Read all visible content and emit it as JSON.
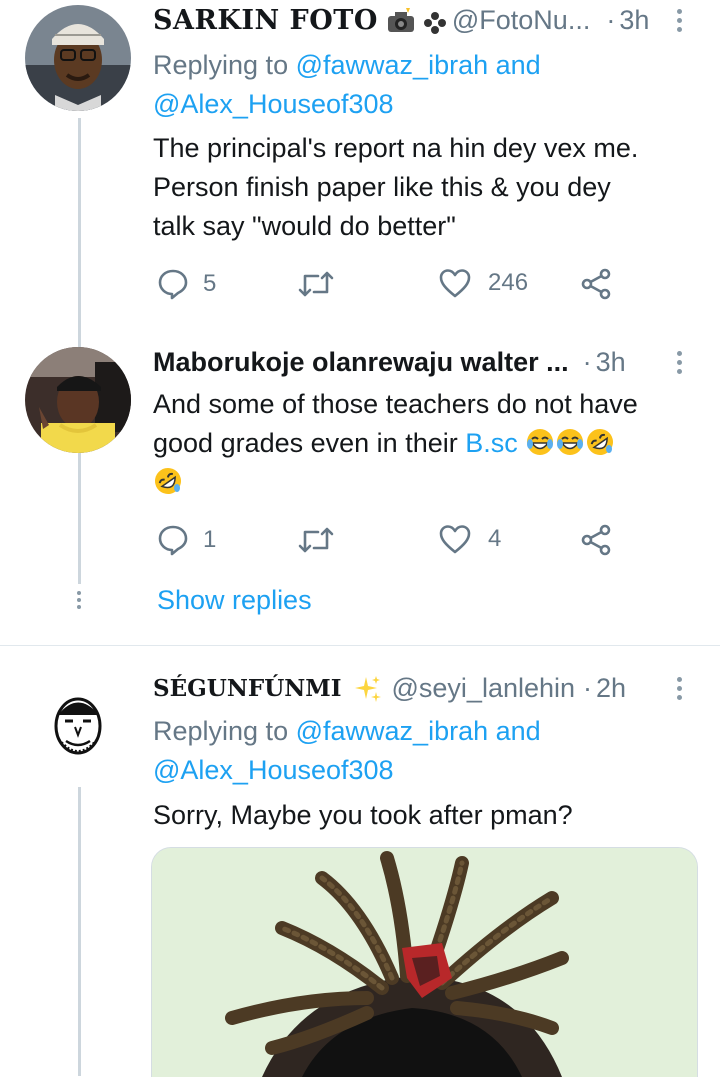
{
  "tweets": [
    {
      "display_name": "SARKIN FOTO",
      "name_emoji": [
        "camera-flash-emoji",
        "flower-emoji"
      ],
      "handle": "@FotoNu...",
      "sep": "·",
      "time": "3h",
      "replying_prefix": "Replying to",
      "replying_user1": "@fawwaz_ibrah",
      "replying_and": "and",
      "replying_user2": "@Alex_Houseof308",
      "text_line1": "The principal's report na hin dey vex me.",
      "text_line2": "Person finish paper like this & you dey",
      "text_line3": "talk say \"would do better\"",
      "replies": "5",
      "likes": "246"
    },
    {
      "display_name": "Maborukoje olanrewaju walter ...",
      "sep": "·",
      "time": "3h",
      "text_line1": "And some of those teachers do not have",
      "text_line2_prefix": "good grades even in their",
      "text_line2_link": "B.sc",
      "emojis": [
        "joy-emoji",
        "joy-emoji",
        "rofl-emoji",
        "rofl-emoji"
      ],
      "replies": "1",
      "likes": "4"
    },
    {
      "display_name": "SÉGUNFÚNMI",
      "name_emoji": [
        "sparkles-emoji"
      ],
      "handle": "@seyi_lanlehin",
      "sep": "·",
      "time": "2h",
      "replying_prefix": "Replying to",
      "replying_user1": "@fawwaz_ibrah",
      "replying_and": "and",
      "replying_user2": "@Alex_Houseof308",
      "text_line1": "Sorry, Maybe you took after pman?"
    }
  ],
  "show_replies": "Show replies",
  "colors": {
    "link": "#1da1f2",
    "muted": "#657786",
    "text": "#14171a",
    "thread": "#cdd6dd"
  }
}
